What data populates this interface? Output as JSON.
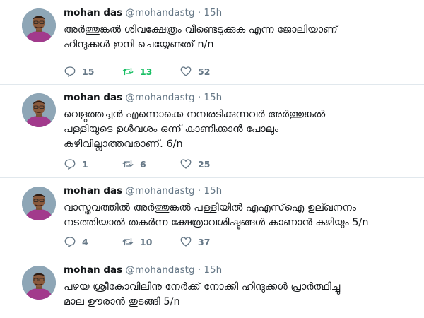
{
  "tweets": [
    {
      "name": "mohan das",
      "handle": "@mohandastg",
      "separator": "·",
      "time": "15h",
      "lines": [
        "അർത്തുങ്കൽ ശിവക്ഷേത്രം വീണ്ടെടുക്കുക എന്ന ജോലിയാണ്",
        "ഹിന്ദുക്കൾ ഇനി ചെയ്യേണ്ടത് n/n"
      ],
      "replies": "15",
      "retweets": "13",
      "likes": "52",
      "retweeted": true
    },
    {
      "name": "mohan das",
      "handle": "@mohandastg",
      "separator": "·",
      "time": "15h",
      "lines": [
        "വെളുത്തച്ചൻ എന്നൊക്കെ നമ്പരടിക്കുന്നവർ അർത്തുങ്കൽ",
        "പള്ളിയുടെ ഉൾവശം ഒന്ന് കാണിക്കാൻ പോലും",
        "കഴിവില്ലാത്തവരാണ്. 6/n"
      ],
      "replies": "1",
      "retweets": "6",
      "likes": "25",
      "retweeted": false
    },
    {
      "name": "mohan das",
      "handle": "@mohandastg",
      "separator": "·",
      "time": "15h",
      "lines": [
        "വാസ്തവത്തിൽ അർത്തുങ്കൽ പള്ളിയിൽ എഎസ്ഐ ഉല്ഖനനം",
        "നടത്തിയാൽ തകർന്ന ക്ഷേത്രാവശിഷ്ടങ്ങൾ കാണാൻ കഴിയും 5/n"
      ],
      "replies": "4",
      "retweets": "10",
      "likes": "37",
      "retweeted": false
    },
    {
      "name": "mohan das",
      "handle": "@mohandastg",
      "separator": "·",
      "time": "15h",
      "lines": [
        "പഴയ ശ്രീകോവിലിനു നേർക്ക് നോക്കി ഹിന്ദുക്കൾ പ്രാർത്ഥിച്ചു",
        "മാല ഊരാൻ തുടങ്ങി 5/n"
      ],
      "replies": null,
      "retweets": null,
      "likes": null,
      "retweeted": false
    }
  ],
  "icons": {
    "reply": "reply-icon",
    "retweet": "retweet-icon",
    "like": "heart-icon"
  },
  "colors": {
    "text_primary": "#14171a",
    "text_secondary": "#657786",
    "retweet_active": "#17bf63",
    "divider": "#e1e8ed",
    "avatar_shirt": "#a23a8c"
  }
}
